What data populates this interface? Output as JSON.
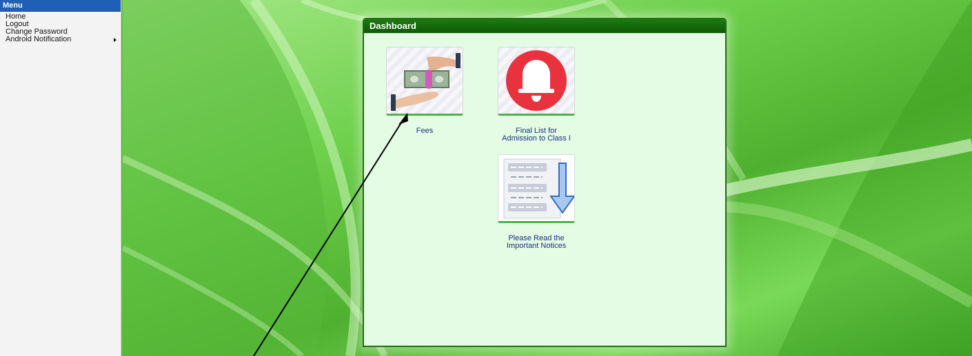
{
  "menu": {
    "title": "Menu",
    "items": [
      {
        "label": "Home"
      },
      {
        "label": "Logout"
      },
      {
        "label": "Change Password"
      },
      {
        "label": "Android Notification",
        "has_submenu": true
      }
    ]
  },
  "dashboard": {
    "title": "Dashboard",
    "tiles": [
      {
        "label": "Fees",
        "icon": "money-hand-icon"
      },
      {
        "label": "Final List for Admission to Class I",
        "icon": "bell-icon"
      },
      {
        "label": "Please Read the Important Notices",
        "icon": "notice-download-icon"
      }
    ]
  },
  "colors": {
    "menu_header": "#1f5fb8",
    "panel_header": "#0e5a06",
    "panel_bg": "#e4fbe4",
    "bell_red": "#e8333e",
    "label_blue": "#1b2f7a"
  }
}
